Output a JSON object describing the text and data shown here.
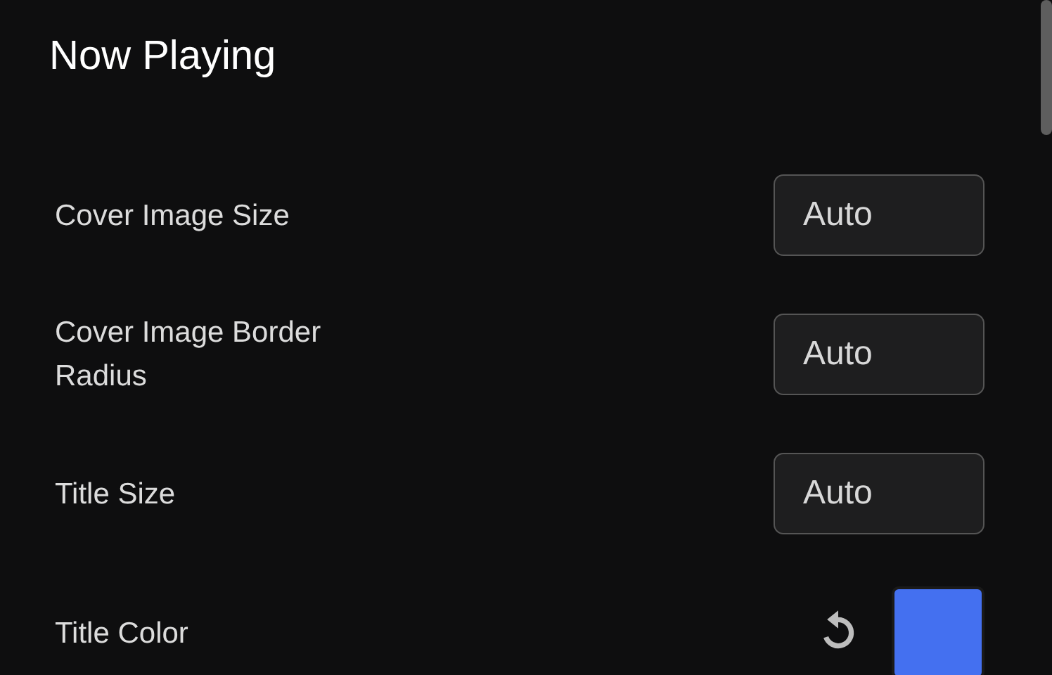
{
  "section": {
    "title": "Now Playing"
  },
  "settings": [
    {
      "kind": "input",
      "label": "Cover Image Size",
      "value": "Auto"
    },
    {
      "kind": "input",
      "label": "Cover Image Border Radius",
      "value": "Auto"
    },
    {
      "kind": "input",
      "label": "Title Size",
      "value": "Auto"
    },
    {
      "kind": "color",
      "label": "Title Color",
      "color": "#4470f0"
    }
  ]
}
